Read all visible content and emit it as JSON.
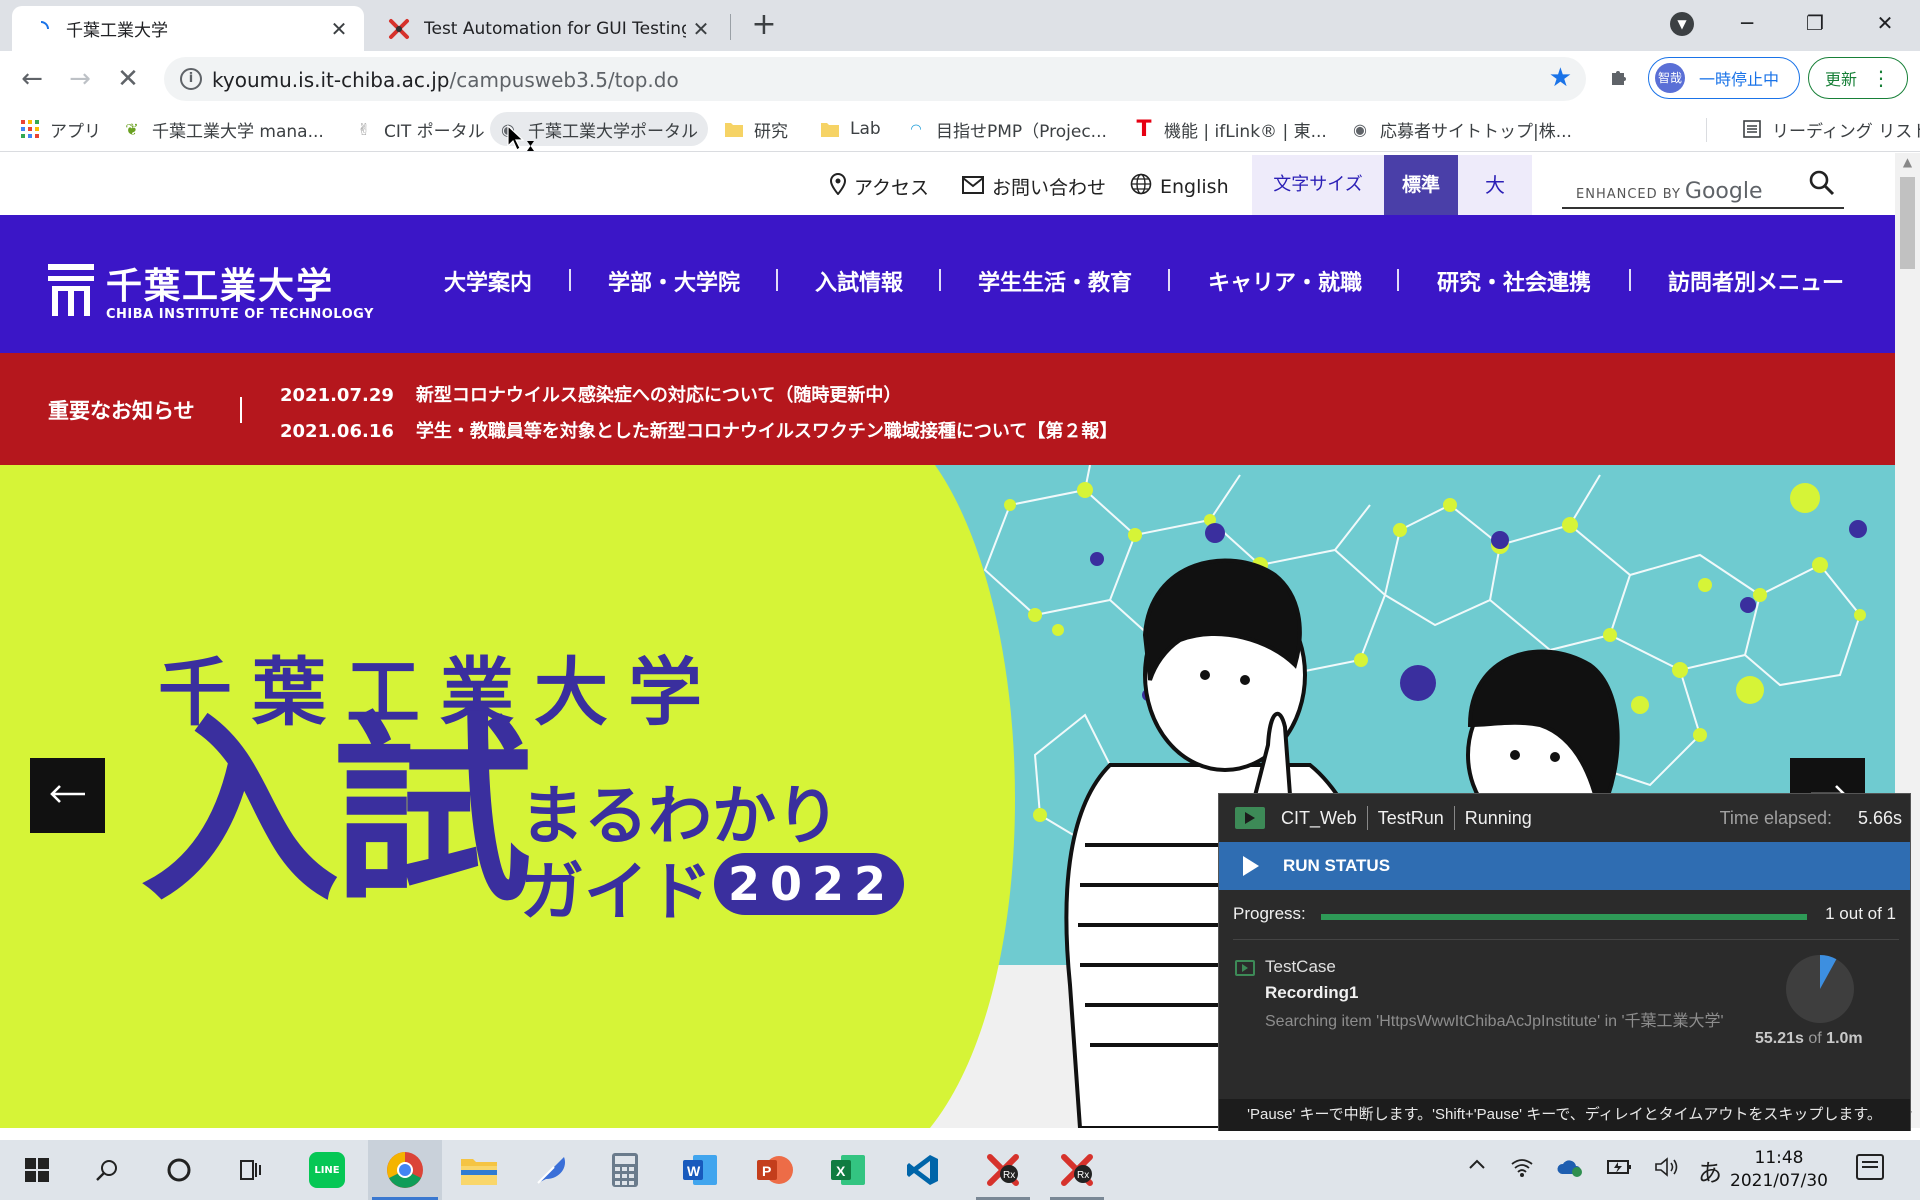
{
  "browser": {
    "tabs": [
      {
        "title": "千葉工業大学",
        "active": true
      },
      {
        "title": "Test Automation for GUI Testing |",
        "active": false
      }
    ],
    "new_tab_symbol": "+",
    "window_controls": {
      "minimize": "─",
      "maximize": "❐",
      "close": "✕"
    },
    "address_bar": {
      "host": "kyoumu.is.it-chiba.ac.jp",
      "path": "/campusweb3.5/top.do"
    },
    "profile": {
      "avatar_text": "智哉",
      "status": "一時停止中"
    },
    "update_button": "更新",
    "bookmarks": [
      {
        "label": "アプリ",
        "icon": "apps-grid-icon"
      },
      {
        "label": "千葉工業大学 mana...",
        "icon": "leaf-icon"
      },
      {
        "label": "CIT ポータル",
        "icon": "bunny-icon"
      },
      {
        "label": "千葉工業大学ポータル",
        "icon": "globe-icon"
      },
      {
        "label": "研究",
        "icon": "folder-icon"
      },
      {
        "label": "Lab",
        "icon": "folder-icon"
      },
      {
        "label": "目指せPMP（Projec...",
        "icon": "pmp-icon"
      },
      {
        "label": "機能 | ifLink® | 東...",
        "icon": "toshiba-t-icon"
      },
      {
        "label": "応募者サイトトップ|株...",
        "icon": "globe-icon"
      }
    ],
    "reading_list": "リーディング リスト"
  },
  "site": {
    "utility_links": {
      "access": "アクセス",
      "contact": "お問い合わせ",
      "english": "English"
    },
    "font_size": {
      "label": "文字サイズ",
      "standard": "標準",
      "large": "大"
    },
    "search": {
      "brand_prefix": "ENHANCED BY",
      "brand": "Google"
    },
    "logo": {
      "jp": "千葉工業大学",
      "en": "CHIBA INSTITUTE OF TECHNOLOGY"
    },
    "nav": [
      "大学案内",
      "学部・大学院",
      "入試情報",
      "学生生活・教育",
      "キャリア・就職",
      "研究・社会連携",
      "訪問者別メニュー"
    ],
    "notice": {
      "label": "重要なお知らせ",
      "items": [
        {
          "date": "2021.07.29",
          "text": "新型コロナウイルス感染症への対応について（随時更新中）"
        },
        {
          "date": "2021.06.16",
          "text": "学生・教職員等を対象とした新型コロナウイルスワクチン職域接種について【第２報】"
        }
      ]
    },
    "hero": {
      "line1": "千葉工業大学",
      "line2_big": "入試",
      "line3a": "まるわかり",
      "line3b": "ガイド",
      "year": "2022",
      "colors": {
        "lime": "#d6f437",
        "navy": "#3a2f9e",
        "teal": "#6fcbd0"
      }
    }
  },
  "ranorex": {
    "solution": "CIT_Web",
    "test": "TestRun",
    "state": "Running",
    "elapsed_label": "Time elapsed:",
    "elapsed": "5.66s",
    "run_status": "RUN STATUS",
    "progress_label": "Progress:",
    "progress_fraction": 1.0,
    "progress_count": "1 out of 1",
    "testcase_label": "TestCase",
    "recording": "Recording1",
    "search_msg": "Searching item 'HttpsWwwItChibaAcJpInstitute' in '千葉工業大学'",
    "timer_elapsed": "55.21s",
    "timer_of": " of ",
    "timer_total": "1.0m",
    "timeout_fraction": 0.08,
    "hint": "'Pause' キーで中断します。'Shift+'Pause' キーで、ディレイとタイムアウトをスキップします。"
  },
  "taskbar": {
    "apps": [
      "windows-start",
      "search",
      "cortana",
      "task-view",
      "line",
      "chrome",
      "file-explorer",
      "feather-app",
      "calculator",
      "word",
      "powerpoint",
      "excel",
      "vscode",
      "ranorex-recorder",
      "ranorex-studio"
    ],
    "ime": "あ",
    "time": "11:48",
    "date": "2021/07/30"
  }
}
